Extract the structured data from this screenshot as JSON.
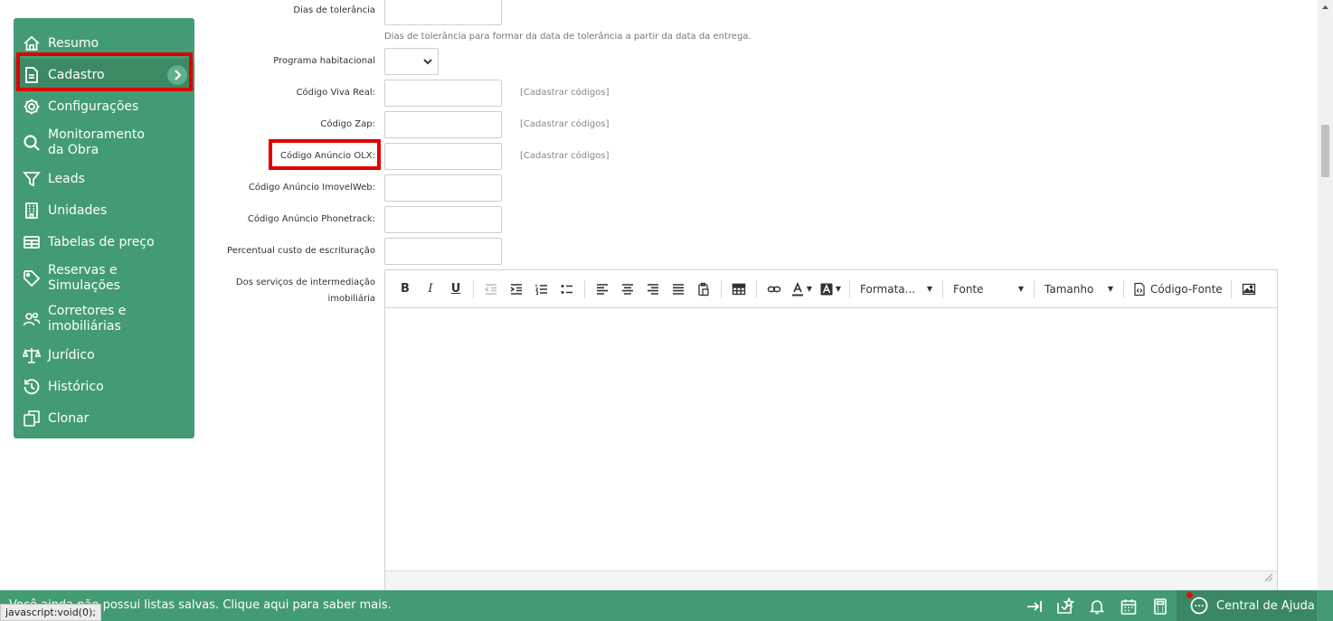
{
  "sidebar": {
    "items": [
      {
        "label": "Resumo",
        "icon": "home-icon"
      },
      {
        "label": "Cadastro",
        "icon": "document-icon",
        "active": true
      },
      {
        "label": "Configurações",
        "icon": "gear-icon"
      },
      {
        "label": "Monitoramento\nda Obra",
        "icon": "search-icon"
      },
      {
        "label": "Leads",
        "icon": "filter-icon"
      },
      {
        "label": "Unidades",
        "icon": "building-icon"
      },
      {
        "label": "Tabelas de preço",
        "icon": "table-icon"
      },
      {
        "label": "Reservas e\nSimulações",
        "icon": "tag-icon"
      },
      {
        "label": "Corretores e\nimobiliárias",
        "icon": "users-icon"
      },
      {
        "label": "Jurídico",
        "icon": "scale-icon"
      },
      {
        "label": "Histórico",
        "icon": "history-icon"
      },
      {
        "label": "Clonar",
        "icon": "clone-icon"
      }
    ]
  },
  "form": {
    "dias_tolerancia_label": "Dias de tolerância",
    "dias_tolerancia_help": "Dias de tolerância para formar da data de tolerância a partir da data da entrega.",
    "programa_habitacional_label": "Programa habitacional",
    "programa_habitacional_value": "",
    "codigo_viva_real_label": "Código Viva Real:",
    "codigo_zap_label": "Código Zap:",
    "codigo_olx_label": "Código Anúncio OLX:",
    "codigo_imovelweb_label": "Código Anúncio ImovelWeb:",
    "codigo_phonetrack_label": "Código Anúncio Phonetrack:",
    "percentual_label": "Percentual custo de escrituração",
    "servicos_label_1": "Dos serviços de intermediação",
    "servicos_label_2": "imobiliária",
    "cadastrar_link": "[Cadastrar códigos]"
  },
  "editor": {
    "bold": "B",
    "italic": "I",
    "underline": "U",
    "format_combo": "Formata...",
    "font_combo": "Fonte",
    "size_combo": "Tamanho",
    "source_label": "Código-Fonte"
  },
  "bottom": {
    "message": "Você ainda não possui listas salvas. Clique aqui para saber mais.",
    "status_url": "javascript:void(0);",
    "help_label": "Central de Ajuda"
  },
  "colors": {
    "sidebar_bg": "#439b73",
    "highlight": "#e00000"
  }
}
